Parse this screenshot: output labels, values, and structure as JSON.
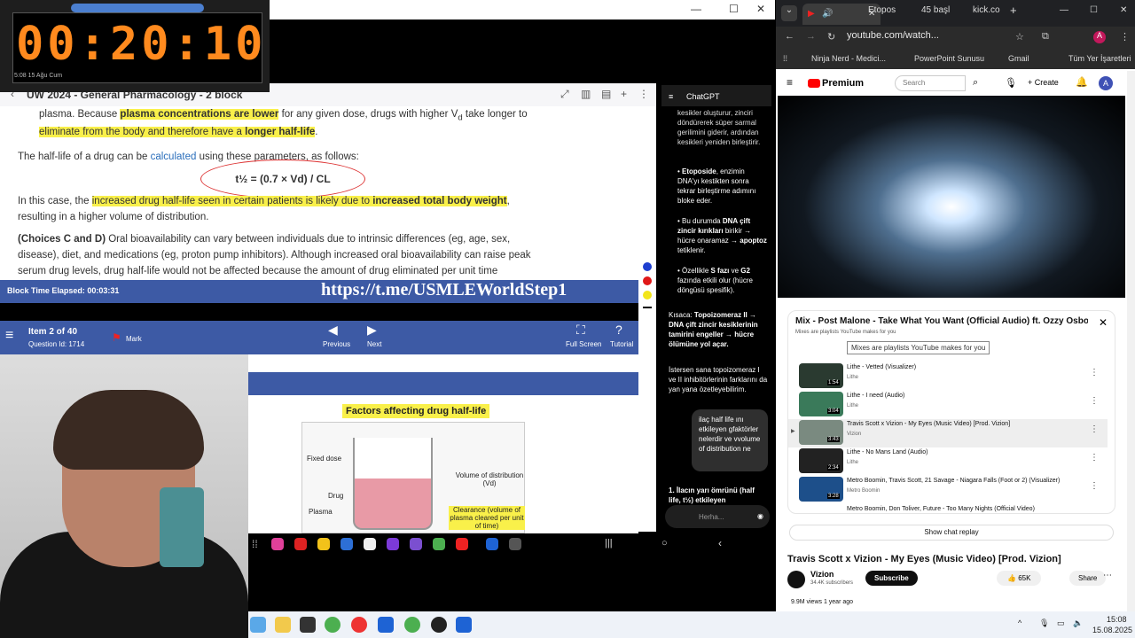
{
  "timer": {
    "display": "00:20:10",
    "small": "5:08  15 Ağu Cum"
  },
  "window": {
    "min": "—",
    "max": "☐",
    "close": "✕"
  },
  "uworld": {
    "title": "UW 2024 - General Pharmacology - 2 block",
    "line1a": "plasma.  Because ",
    "line1b": "plasma concentrations are lower",
    "line1c": " for any given dose, drugs with higher V",
    "line1d": " take longer to",
    "line2a": "eliminate from the body and therefore have a ",
    "line2b": "longer half-life",
    "line3a": "The half-life of a drug can be ",
    "line3b": "calculated",
    "line3c": " using these parameters, as follows:",
    "formula": "t½ = (0.7 × Vd) / CL",
    "line4a": "In this case, the ",
    "line4b": "increased drug half-life seen in certain patients is likely due to ",
    "line4c": "increased total body weight",
    "line5": "resulting in a higher volume of distribution.",
    "line6a": "(Choices C and D)",
    "line6b": "  Oral bioavailability can vary between individuals due to intrinsic differences (eg, age, sex,",
    "line7": "disease), diet, and medications (eg, proton pump inhibitors).  Although increased oral bioavailability can raise peak",
    "line8": "serum drug levels, drug half-life would not be affected because the amount of drug eliminated per unit time",
    "elapsed": "Block Time Elapsed: 00:03:31",
    "url": "https://t.me/USMLEWorldStep1",
    "item": "Item 2 of 40",
    "qid": "Question Id: 1714",
    "mark": "Mark",
    "previous": "Previous",
    "next": "Next",
    "fullscreen": "Full Screen",
    "tutorial": "Tutorial",
    "figure_title": "Factors affecting drug half-life",
    "fixed_dose": "Fixed dose",
    "drug": "Drug",
    "plasma": "Plasma",
    "vd": "Volume of distribution (Vd)",
    "clearance": "Clearance (volume of plasma cleared per unit of time)"
  },
  "chat": {
    "title": "ChatGPT",
    "p1": "kesikler oluşturur, zinciri döndürerek süper sarmal gerilimini giderir, ardından kesikleri yeniden birleştirir.",
    "p2a": "Etoposide",
    "p2b": ", enzimin DNA'yı kestikten sonra tekrar birleştirme adımını bloke eder.",
    "p3a": "Bu durumda ",
    "p3b": "DNA çift zincir kırıkları",
    "p3c": " birikir → hücre onaramaz → ",
    "p3d": "apoptoz",
    "p3e": " tetiklenir.",
    "p4a": "Özellikle ",
    "p4b": "S fazı",
    "p4c": " ve ",
    "p4d": "G2",
    "p4e": " fazında etkili olur (hücre döngüsü spesifik).",
    "p5a": "Kısaca: ",
    "p5b": "Topoizomeraz II → DNA çift zincir kesiklerinin tamirini engeller → hücre ölümüne yol açar.",
    "p6": "İstersen sana topoizomeraz I ve II inhibitörlerinin farklarını da yan yana özetleyebilirim.",
    "bubble": "ilaç half life ını etkileyen gfaktörler nelerdir ve vvolume of distribution ne",
    "p7": "1. İlacın yarı ömrünü (half life, t½) etkileyen",
    "input": "Herha..."
  },
  "browser": {
    "tab1": "Etopos",
    "tab2": "45 başl",
    "tab3": "kick.co",
    "url": "youtube.com/watch...",
    "bm1": "Ninja Nerd - Medici...",
    "bm2": "PowerPoint Sunusu",
    "bm3": "Gmail",
    "bm4": "Tüm Yer İşaretleri"
  },
  "youtube": {
    "logo": "Premium",
    "search": "Search",
    "create": "+ Create",
    "avatar": "A",
    "playlist_title": "Mix - Post Malone - Take What You Want (Official Audio) ft. Ozzy Osbourne...",
    "playlist_sub": "Mixes are playlists YouTube makes for you",
    "tooltip": "Mixes are playlists YouTube makes for you",
    "items": [
      {
        "name": "Lithe - Vetted (Visualizer)",
        "channel": "Lithe",
        "dur": "1:54"
      },
      {
        "name": "Lithe - I need (Audio)",
        "channel": "Lithe",
        "dur": "3:04"
      },
      {
        "name": "Travis Scott x Vizion - My Eyes (Music Video) [Prod. Vizion]",
        "channel": "Vizion",
        "dur": "3:43"
      },
      {
        "name": "Lithe - No Mans Land (Audio)",
        "channel": "Lithe",
        "dur": "2:34"
      },
      {
        "name": "Metro Boomin, Travis Scott, 21 Savage - Niagara Falls (Foot or 2) (Visualizer)",
        "channel": "Metro Boomin",
        "dur": "3:28"
      },
      {
        "name": "Metro Boomin, Don Toliver, Future - Too Many Nights (Official Video)",
        "channel": "",
        "dur": ""
      }
    ],
    "show_replay": "Show chat replay",
    "video_title": "Travis Scott x Vizion - My Eyes (Music Video) [Prod. Vizion]",
    "channel": "Vizion",
    "subs": "34.4K subscribers",
    "subscribe": "Subscribe",
    "likes": "65K",
    "share": "Share",
    "views": "9.9M views  1 year ago"
  },
  "taskbar": {
    "time": "15:08",
    "date": "15.08.2025"
  }
}
